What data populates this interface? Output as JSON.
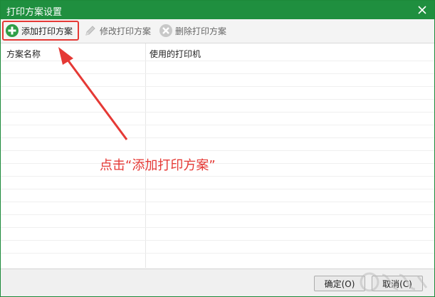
{
  "window": {
    "title": "打印方案设置"
  },
  "toolbar": {
    "add_label": "添加打印方案",
    "edit_label": "修改打印方案",
    "delete_label": "删除打印方案"
  },
  "table": {
    "columns": [
      "方案名称",
      "使用的打印机"
    ],
    "rows": []
  },
  "annotation": {
    "text": "点击“添加打印方案”"
  },
  "footer": {
    "ok_label": "确定(O)",
    "cancel_label": "取消(C)"
  },
  "colors": {
    "titlebar": "#1f8f3f",
    "highlight": "#e53935",
    "add_icon": "#2e9e46"
  },
  "icons": {
    "close": "close-icon",
    "add": "plus-circle-icon",
    "edit": "pencil-icon",
    "delete": "x-circle-icon"
  }
}
